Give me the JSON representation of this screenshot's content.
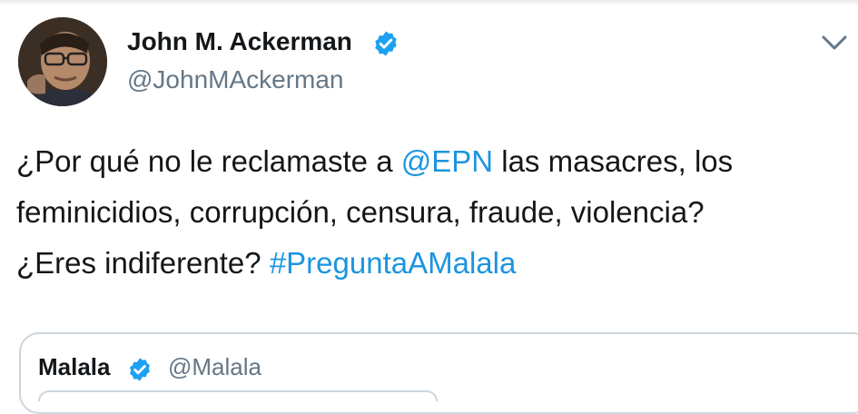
{
  "author": {
    "name": "John M. Ackerman",
    "handle": "@JohnMAckerman",
    "verified": true,
    "avatar_icon": "profile-photo"
  },
  "tweet": {
    "line1_before": "¿Por qué no le reclamaste a ",
    "line1_mention": "@EPN",
    "line1_after": " las masacres, los",
    "line2": "feminicidios, corrupción, censura, fraude, violencia?",
    "line3_before": "¿Eres indiferente? ",
    "line3_hashtag": "#PreguntaAMalala"
  },
  "quoted": {
    "name": "Malala",
    "handle": "@Malala",
    "verified": true
  },
  "colors": {
    "link": "#1b95e0",
    "verified_badge": "#1da1f2",
    "secondary_text": "#657786",
    "border": "#ccd6dd"
  },
  "icons": {
    "menu": "chevron-down-icon",
    "verified": "verified-badge-icon"
  }
}
